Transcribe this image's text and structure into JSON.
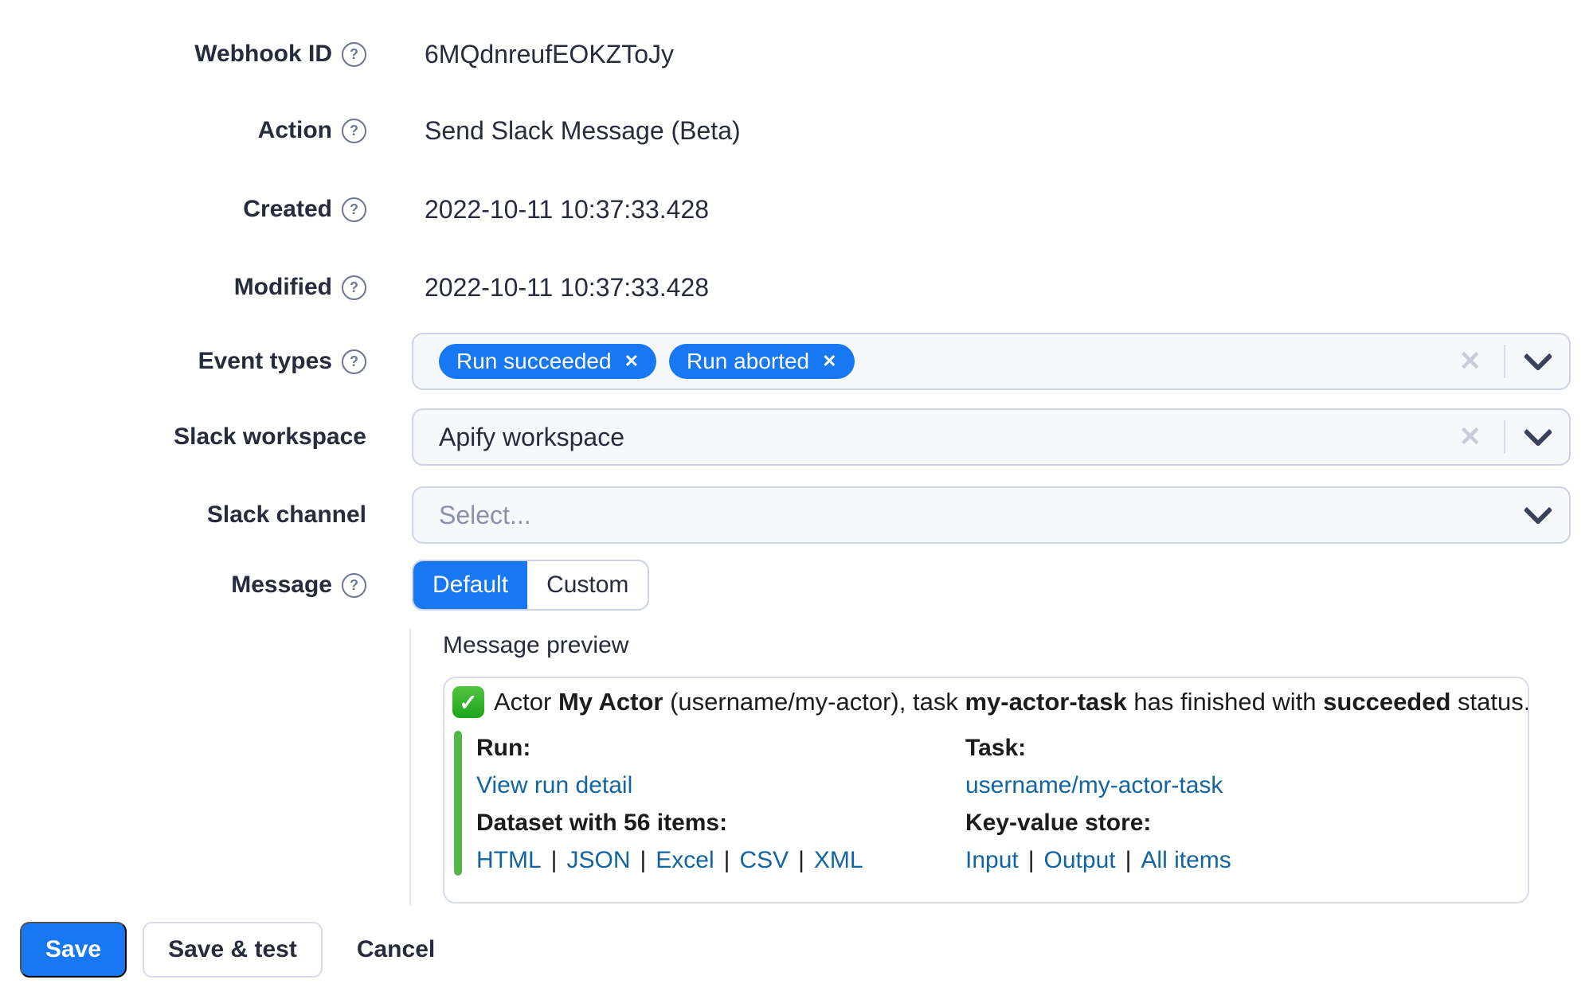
{
  "form": {
    "rows": [
      {
        "label": "Webhook ID",
        "value": "6MQdnreufEOKZToJy"
      },
      {
        "label": "Action",
        "value": "Send Slack Message (Beta)"
      },
      {
        "label": "Created",
        "value": "2022-10-11 10:37:33.428"
      },
      {
        "label": "Modified",
        "value": "2022-10-11 10:37:33.428"
      }
    ],
    "event_types": {
      "label": "Event types",
      "tags": [
        {
          "label": "Run succeeded"
        },
        {
          "label": "Run aborted"
        }
      ]
    },
    "slack_workspace": {
      "label": "Slack workspace",
      "value": "Apify workspace"
    },
    "slack_channel": {
      "label": "Slack channel",
      "placeholder": "Select..."
    },
    "message": {
      "label": "Message",
      "options": [
        {
          "label": "Default"
        },
        {
          "label": "Custom"
        }
      ]
    }
  },
  "preview": {
    "title": "Message preview",
    "sentence": [
      "Actor ",
      "My Actor",
      " (username/my-actor), task ",
      "my-actor-task",
      " has finished with ",
      "succeeded",
      " status."
    ],
    "run": {
      "heading": "Run:",
      "link": "View run detail"
    },
    "task": {
      "heading": "Task:",
      "link": "username/my-actor-task"
    },
    "dataset": {
      "heading": "Dataset with 56 items:",
      "links": [
        "HTML",
        "JSON",
        "Excel",
        "CSV",
        "XML"
      ]
    },
    "kv": {
      "heading": "Key-value store:",
      "links": [
        "Input",
        "Output",
        "All items"
      ]
    },
    "separator": "|"
  },
  "actions": {
    "save": "Save",
    "save_test": "Save & test",
    "cancel": "Cancel"
  },
  "icons": {
    "help": "?",
    "clear": "✕",
    "remove": "✕",
    "check": "✓"
  },
  "colors": {
    "accent_blue": "#1877f2",
    "text_dark": "#272c3d",
    "slack_link_blue": "#1264a3",
    "attachment_green": "#53b54a",
    "field_border": "#ced4e8",
    "field_background": "#f7f8fc"
  }
}
